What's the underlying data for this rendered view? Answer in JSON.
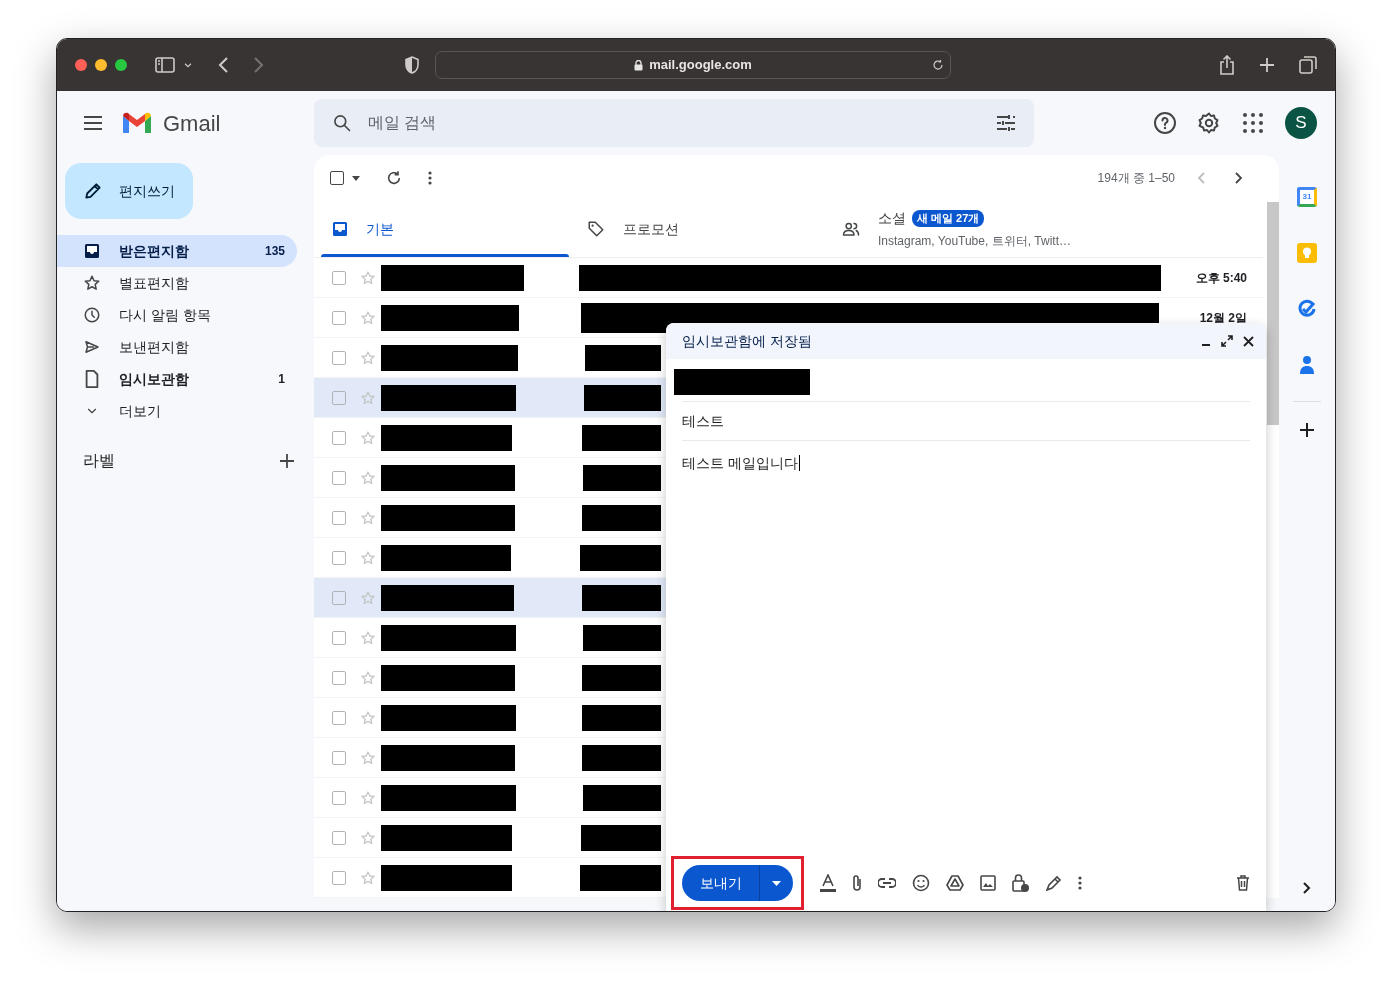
{
  "browser": {
    "url": "mail.google.com"
  },
  "app": {
    "name": "Gmail"
  },
  "search": {
    "placeholder": "메일 검색"
  },
  "account": {
    "initial": "S"
  },
  "compose_button": {
    "label": "편지쓰기"
  },
  "sidebar": {
    "items": [
      {
        "kind": "inbox",
        "label": "받은편지함",
        "count": "135",
        "selected": true,
        "unread": true
      },
      {
        "kind": "star",
        "label": "별표편지함",
        "selected": false,
        "unread": false
      },
      {
        "kind": "clock",
        "label": "다시 알림 항목",
        "selected": false,
        "unread": false
      },
      {
        "kind": "sent",
        "label": "보낸편지함",
        "selected": false,
        "unread": false
      },
      {
        "kind": "draft",
        "label": "임시보관함",
        "count": "1",
        "selected": false,
        "unread": true
      },
      {
        "kind": "more",
        "label": "더보기",
        "selected": false,
        "unread": false
      }
    ],
    "labels_title": "라벨"
  },
  "toolbar": {
    "range": "194개 중 1–50",
    "select_all_checked": false
  },
  "tabs": [
    {
      "kind": "inbox",
      "label": "기본",
      "selected": true
    },
    {
      "kind": "tag",
      "label": "프로모션",
      "selected": false
    },
    {
      "kind": "people",
      "label": "소셜",
      "selected": false,
      "badge": "새 메일 27개",
      "subtitle": "Instagram, YouTube, 트위터, Twitt…"
    }
  ],
  "messages": [
    {
      "highlighted": false,
      "time": "오후 5:40"
    },
    {
      "highlighted": false,
      "time": "12월 2일"
    },
    {
      "highlighted": false
    },
    {
      "highlighted": true
    },
    {
      "highlighted": false
    },
    {
      "highlighted": false
    },
    {
      "highlighted": false
    },
    {
      "highlighted": false
    },
    {
      "highlighted": true
    },
    {
      "highlighted": false
    },
    {
      "highlighted": false
    },
    {
      "highlighted": false
    },
    {
      "highlighted": false
    },
    {
      "highlighted": false
    },
    {
      "highlighted": false
    },
    {
      "highlighted": false
    }
  ],
  "compose": {
    "title": "임시보관함에 저장됨",
    "subject": "테스트",
    "body": "테스트 메일입니다",
    "send_label": "보내기",
    "send_highlighted": true
  },
  "side_panel": [
    {
      "kind": "calendar",
      "label": "31"
    },
    {
      "kind": "keep"
    },
    {
      "kind": "tasks"
    },
    {
      "kind": "contacts"
    }
  ]
}
